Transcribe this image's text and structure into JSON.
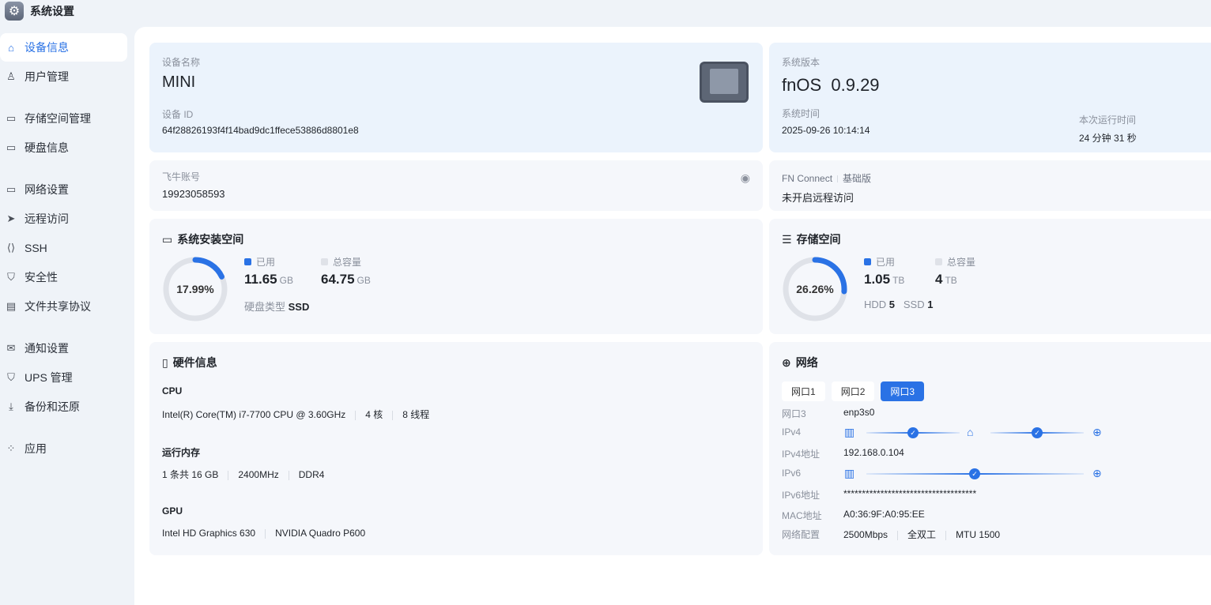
{
  "app": {
    "title": "系统设置"
  },
  "sidebar": {
    "items": [
      {
        "label": "设备信息"
      },
      {
        "label": "用户管理"
      },
      {
        "label": "存储空间管理"
      },
      {
        "label": "硬盘信息"
      },
      {
        "label": "网络设置"
      },
      {
        "label": "远程访问"
      },
      {
        "label": "SSH"
      },
      {
        "label": "安全性"
      },
      {
        "label": "文件共享协议"
      },
      {
        "label": "通知设置"
      },
      {
        "label": "UPS 管理"
      },
      {
        "label": "备份和还原"
      },
      {
        "label": "应用"
      }
    ]
  },
  "device": {
    "name_label": "设备名称",
    "name": "MINI",
    "id_label": "设备 ID",
    "id": "64f28826193f4f14bad9dc1ffece53886d8801e8"
  },
  "system": {
    "version_label": "系统版本",
    "os": "fnOS",
    "version": "0.9.29",
    "time_label": "系统时间",
    "time": "2025-09-26 10:14:14",
    "uptime_label": "本次运行时间",
    "uptime": "24 分钟 31 秒"
  },
  "account": {
    "label": "飞牛账号",
    "value": "19923058593"
  },
  "connect": {
    "label": "FN Connect",
    "plan": "基础版",
    "status": "未开启远程访问"
  },
  "sys_space": {
    "title": "系统安装空间",
    "percent": 17.99,
    "percent_text": "17.99%",
    "used_label": "已用",
    "used": "11.65",
    "used_unit": "GB",
    "total_label": "总容量",
    "total": "64.75",
    "total_unit": "GB",
    "disk_type_label": "硬盘类型",
    "disk_type": "SSD"
  },
  "storage": {
    "title": "存储空间",
    "percent": 26.26,
    "percent_text": "26.26%",
    "used_label": "已用",
    "used": "1.05",
    "used_unit": "TB",
    "total_label": "总容量",
    "total": "4",
    "total_unit": "TB",
    "hdd_label": "HDD",
    "hdd": "5",
    "ssd_label": "SSD",
    "ssd": "1"
  },
  "hardware": {
    "title": "硬件信息",
    "cpu_label": "CPU",
    "cpu": "Intel(R) Core(TM) i7-7700 CPU @ 3.60GHz",
    "cores": "4 核",
    "threads": "8 线程",
    "mem_label": "运行内存",
    "mem": "1 条共 16 GB",
    "mem_speed": "2400MHz",
    "mem_type": "DDR4",
    "gpu_label": "GPU",
    "gpu1": "Intel HD Graphics 630",
    "gpu2": "NVIDIA Quadro P600"
  },
  "network": {
    "title": "网络",
    "tabs": [
      "网口1",
      "网口2",
      "网口3"
    ],
    "active_tab": 2,
    "rows": {
      "port_k": "网口3",
      "port_v": "enp3s0",
      "ipv4_k": "IPv4",
      "ipv4addr_k": "IPv4地址",
      "ipv4addr_v": "192.168.0.104",
      "ipv6_k": "IPv6",
      "ipv6addr_k": "IPv6地址",
      "ipv6addr_v": "************************************",
      "mac_k": "MAC地址",
      "mac_v": "A0:36:9F:A0:95:EE",
      "cfg_k": "网络配置",
      "speed": "2500Mbps",
      "duplex": "全双工",
      "mtu": "MTU 1500"
    }
  },
  "colors": {
    "accent": "#2a72e5",
    "ring_bg": "#dfe2e8"
  }
}
